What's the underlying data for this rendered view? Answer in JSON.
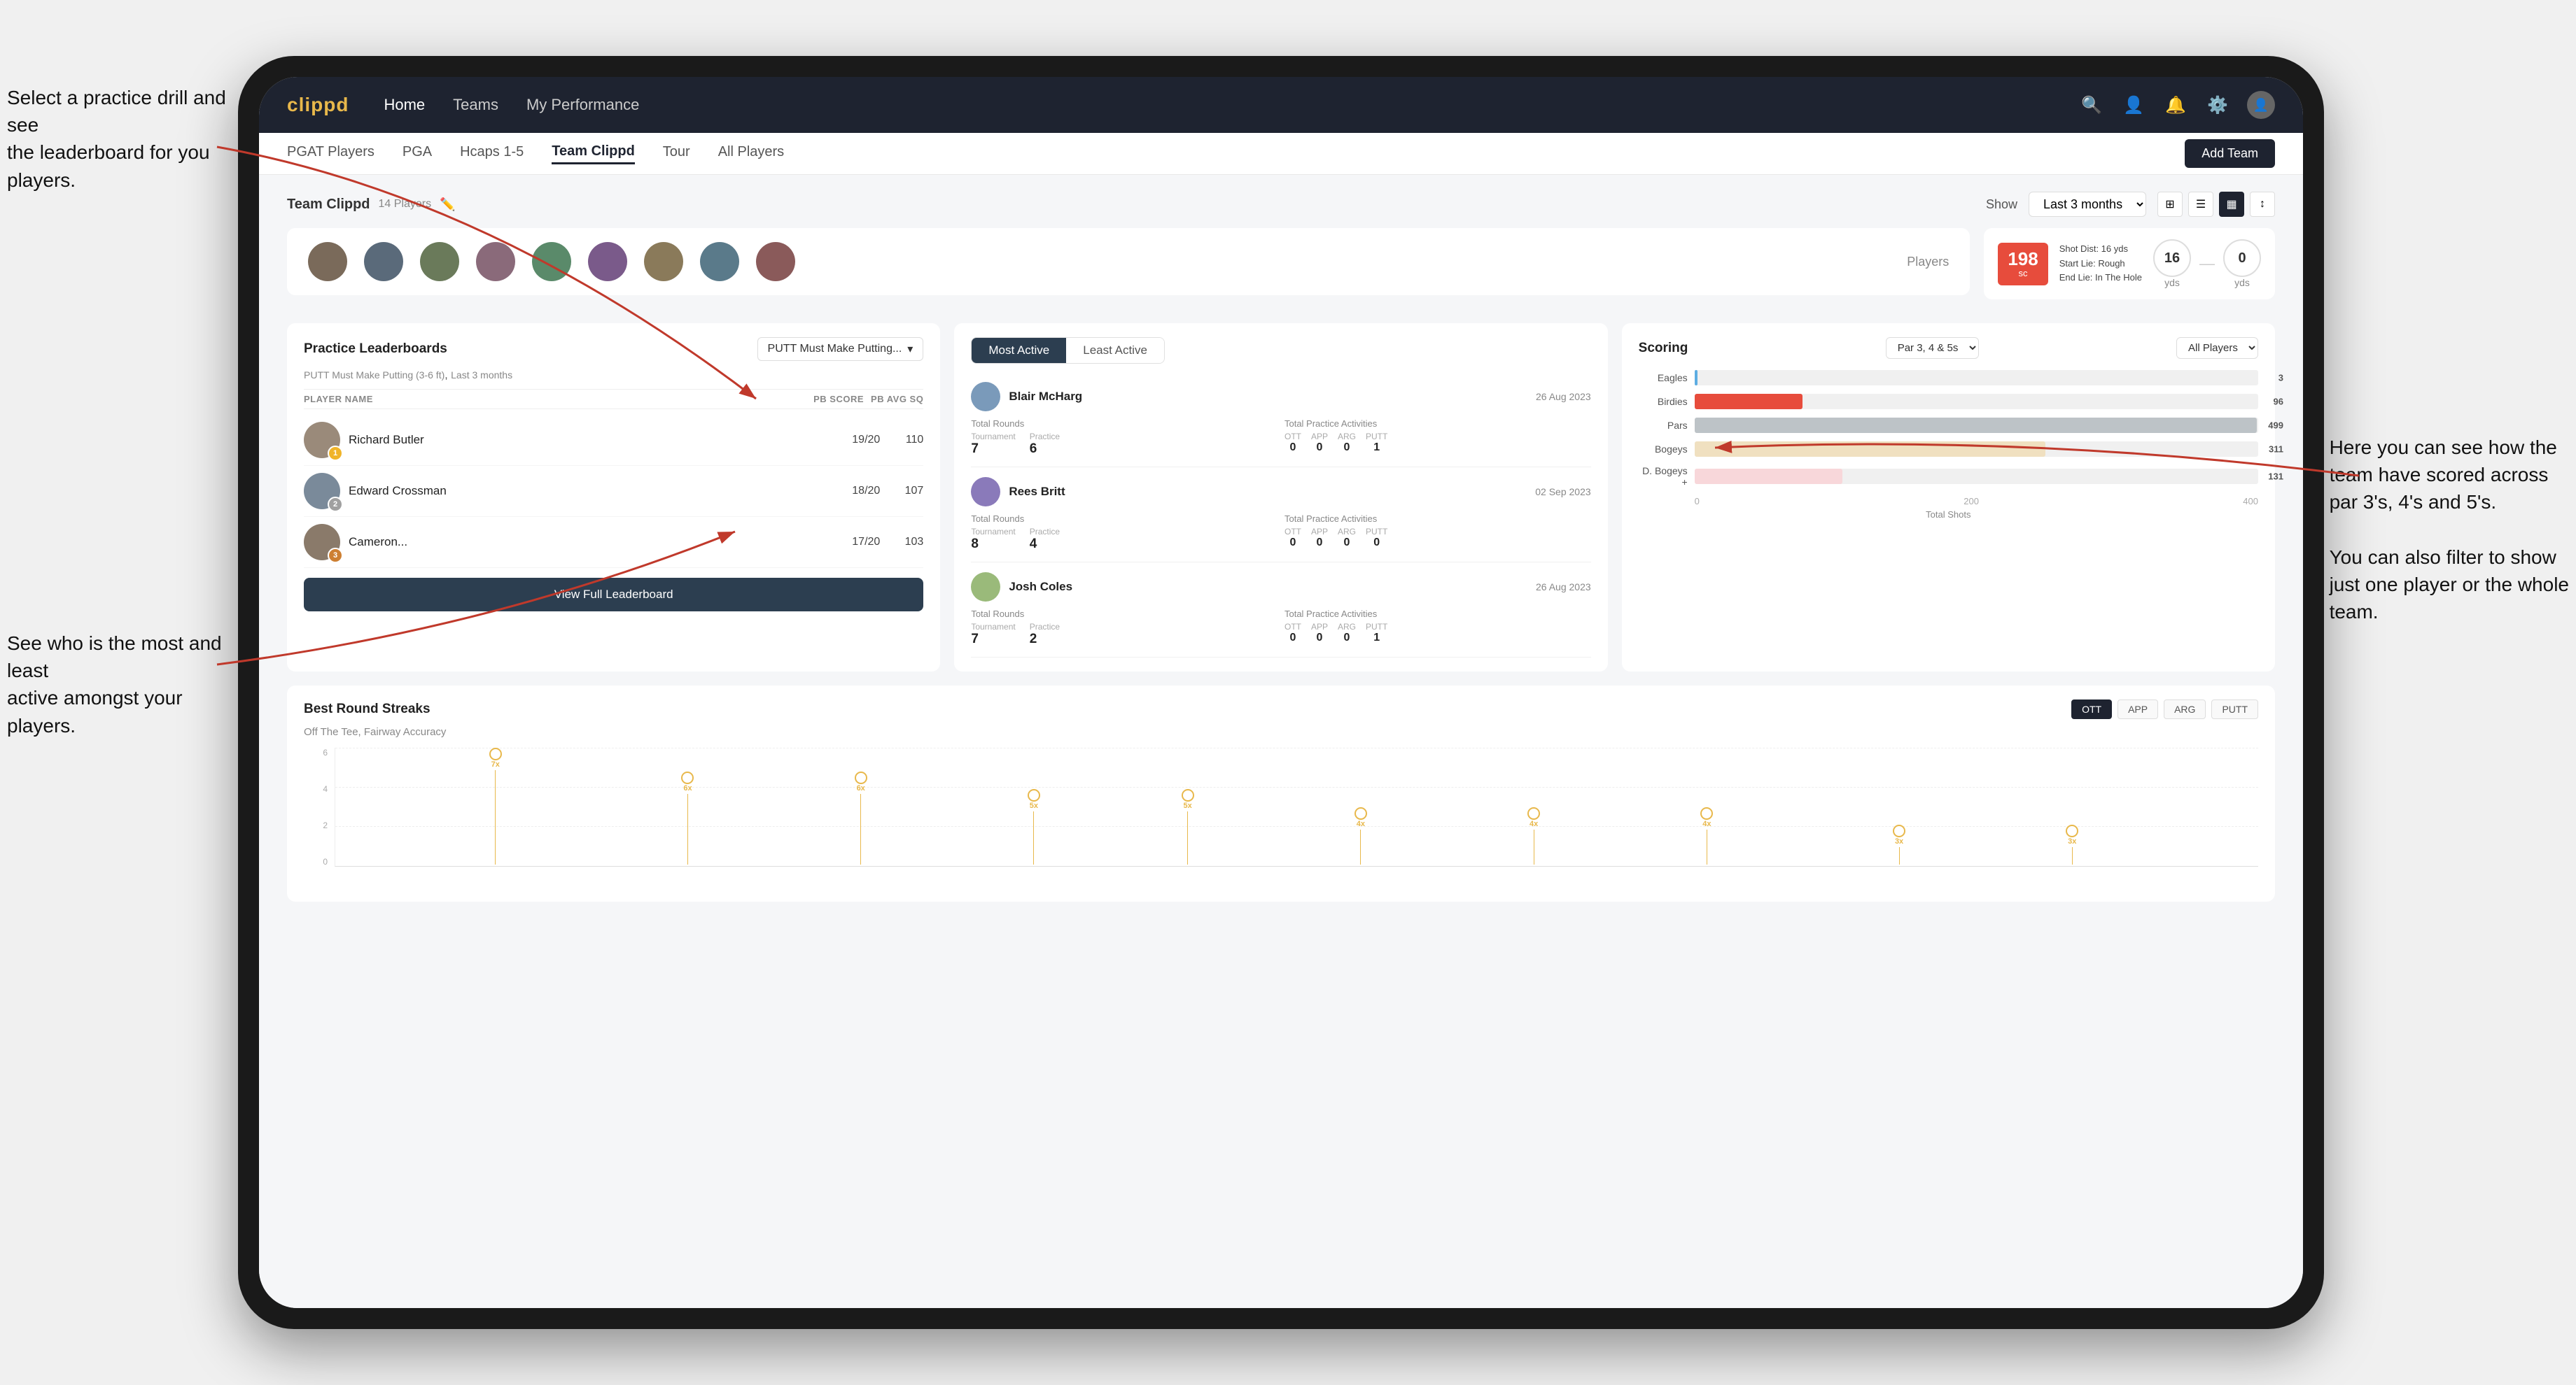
{
  "annotations": {
    "top_left": "Select a practice drill and see\nthe leaderboard for you players.",
    "bottom_left": "See who is the most and least\nactive amongst your players.",
    "right": "Here you can see how the\nteam have scored across\npar 3's, 4's and 5's.\n\nYou can also filter to show\njust one player or the whole\nteam."
  },
  "nav": {
    "logo": "clippd",
    "items": [
      "Home",
      "Teams",
      "My Performance"
    ],
    "icons": [
      "search",
      "person",
      "bell",
      "settings",
      "avatar"
    ]
  },
  "sub_nav": {
    "items": [
      "PGAT Players",
      "PGA",
      "Hcaps 1-5",
      "Team Clippd",
      "Tour",
      "All Players"
    ],
    "active": "Team Clippd",
    "add_team_label": "Add Team"
  },
  "team_header": {
    "title": "Team Clippd",
    "player_count": "14 Players",
    "show_label": "Show",
    "show_value": "Last 3 months",
    "players_label": "Players"
  },
  "shot_info": {
    "distance": "198",
    "distance_unit": "sc",
    "shot_dist_label": "Shot Dist: 16 yds",
    "start_lie_label": "Start Lie: Rough",
    "end_lie_label": "End Lie: In The Hole",
    "yards_left": "16",
    "yards_right": "0",
    "yards_label": "yds"
  },
  "practice_leaderboards": {
    "title": "Practice Leaderboards",
    "drill_selector_label": "PUTT Must Make Putting...",
    "drill_full_name": "PUTT Must Make Putting (3-6 ft)",
    "drill_period": "Last 3 months",
    "col_player": "PLAYER NAME",
    "col_score": "PB SCORE",
    "col_avg": "PB AVG SQ",
    "players": [
      {
        "name": "Richard Butler",
        "score": "19/20",
        "avg": "110",
        "rank": 1
      },
      {
        "name": "Edward Crossman",
        "score": "18/20",
        "avg": "107",
        "rank": 2
      },
      {
        "name": "Cameron...",
        "score": "17/20",
        "avg": "103",
        "rank": 3
      }
    ],
    "view_full_label": "View Full Leaderboard"
  },
  "activity": {
    "tabs": [
      "Most Active",
      "Least Active"
    ],
    "active_tab": "Most Active",
    "players": [
      {
        "name": "Blair McHarg",
        "date": "26 Aug 2023",
        "total_rounds_label": "Total Rounds",
        "tournament": "7",
        "practice": "6",
        "total_practice_label": "Total Practice Activities",
        "ott": "0",
        "app": "0",
        "arg": "0",
        "putt": "1"
      },
      {
        "name": "Rees Britt",
        "date": "02 Sep 2023",
        "total_rounds_label": "Total Rounds",
        "tournament": "8",
        "practice": "4",
        "total_practice_label": "Total Practice Activities",
        "ott": "0",
        "app": "0",
        "arg": "0",
        "putt": "0"
      },
      {
        "name": "Josh Coles",
        "date": "26 Aug 2023",
        "total_rounds_label": "Total Rounds",
        "tournament": "7",
        "practice": "2",
        "total_practice_label": "Total Practice Activities",
        "ott": "0",
        "app": "0",
        "arg": "0",
        "putt": "1"
      }
    ]
  },
  "scoring": {
    "title": "Scoring",
    "filter_par": "Par 3, 4 & 5s",
    "filter_players": "All Players",
    "categories": [
      {
        "label": "Eagles",
        "value": 3,
        "max": 500,
        "color": "#5dade2"
      },
      {
        "label": "Birdies",
        "value": 96,
        "max": 500,
        "color": "#e74c3c"
      },
      {
        "label": "Pars",
        "value": 499,
        "max": 500,
        "color": "#bdc3c7"
      },
      {
        "label": "Bogeys",
        "value": 311,
        "max": 500,
        "color": "#f0c080"
      },
      {
        "label": "D. Bogeys +",
        "value": 131,
        "max": 500,
        "color": "#f8d7da"
      }
    ],
    "x_labels": [
      "0",
      "200",
      "400"
    ],
    "x_title": "Total Shots"
  },
  "best_round_streaks": {
    "title": "Best Round Streaks",
    "subtitle": "Off The Tee, Fairway Accuracy",
    "filters": [
      "OTT",
      "APP",
      "ARG",
      "PUTT"
    ],
    "active_filter": "OTT",
    "y_labels": [
      "6",
      "4",
      "2",
      "0"
    ],
    "streak_dots": [
      {
        "label": "7x",
        "position": 0.08
      },
      {
        "label": "6x",
        "position": 0.18
      },
      {
        "label": "6x",
        "position": 0.26
      },
      {
        "label": "5x",
        "position": 0.36
      },
      {
        "label": "5x",
        "position": 0.44
      },
      {
        "label": "4x",
        "position": 0.54
      },
      {
        "label": "4x",
        "position": 0.62
      },
      {
        "label": "4x",
        "position": 0.7
      },
      {
        "label": "3x",
        "position": 0.8
      },
      {
        "label": "3x",
        "position": 0.88
      }
    ]
  }
}
